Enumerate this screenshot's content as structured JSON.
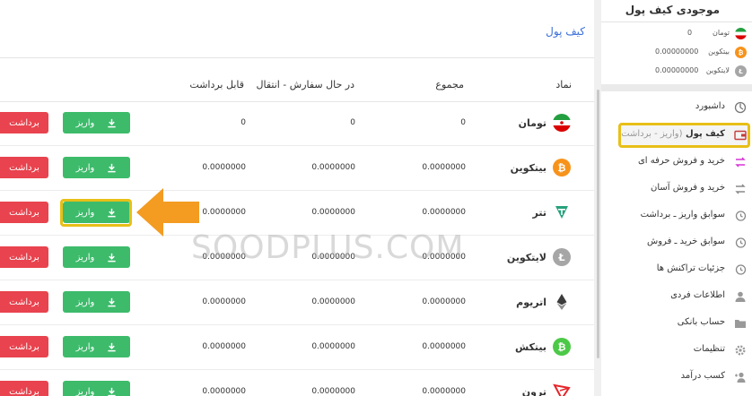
{
  "page_title": "کیف پول",
  "table": {
    "headers": {
      "asset": "نماد",
      "total": "مجموع",
      "in_order": "در حال سفارش - انتقال",
      "withdrawable": "قابل برداشت"
    },
    "deposit_label": "واریز",
    "withdraw_label": "برداشت",
    "rows": [
      {
        "name": "تومان",
        "total": "0",
        "in_order": "0",
        "withdrawable": "0",
        "icon": "iran-flag-icon",
        "color": "#ffffff"
      },
      {
        "name": "بیتکوین",
        "total": "0.0000000",
        "in_order": "0.0000000",
        "withdrawable": "0.0000000",
        "icon": "bitcoin-icon",
        "color": "#f7931a"
      },
      {
        "name": "تتر",
        "total": "0.0000000",
        "in_order": "0.0000000",
        "withdrawable": "0.0000000",
        "icon": "tether-icon",
        "color": "#26a17b"
      },
      {
        "name": "لایتکوین",
        "total": "0.0000000",
        "in_order": "0.0000000",
        "withdrawable": "0.0000000",
        "icon": "litecoin-icon",
        "color": "#a6a6a6"
      },
      {
        "name": "اتریوم",
        "total": "0.0000000",
        "in_order": "0.0000000",
        "withdrawable": "0.0000000",
        "icon": "ethereum-icon",
        "color": "#3c3c3d"
      },
      {
        "name": "بیتکش",
        "total": "0.0000000",
        "in_order": "0.0000000",
        "withdrawable": "0.0000000",
        "icon": "bitcoin-cash-icon",
        "color": "#4cc947"
      },
      {
        "name": "ترون",
        "total": "0.0000000",
        "in_order": "0.0000000",
        "withdrawable": "0.0000000",
        "icon": "tron-icon",
        "color": "#e5262b"
      }
    ]
  },
  "watermark": "SOODPLUS.COM",
  "sidebar": {
    "title": "موجودی کیف پول",
    "balances": [
      {
        "name": "تومان",
        "value": "0"
      },
      {
        "name": "بیتکوین",
        "value": "0.00000000"
      },
      {
        "name": "لایتکوین",
        "value": "0.00000000"
      }
    ],
    "menu": [
      {
        "label": "داشبورد",
        "icon": "dashboard-icon"
      },
      {
        "label": "کیف پول",
        "sub": "(واریز - برداشت)",
        "icon": "wallet-icon",
        "active": true
      },
      {
        "label": "خرید و فروش حرفه ای",
        "icon": "pro-trade-icon"
      },
      {
        "label": "خرید و فروش آسان",
        "icon": "easy-trade-icon"
      },
      {
        "label": "سوابق واریز ـ برداشت",
        "icon": "history-icon"
      },
      {
        "label": "سوابق خرید ـ فروش",
        "icon": "history-icon"
      },
      {
        "label": "جزئیات تراکنش ها",
        "icon": "history-icon"
      },
      {
        "label": "اطلاعات فردی",
        "icon": "user-icon"
      },
      {
        "label": "حساب بانکی",
        "icon": "bank-folder-icon"
      },
      {
        "label": "تنظیمات",
        "icon": "gear-icon"
      },
      {
        "label": "کسب درآمد",
        "icon": "add-user-icon"
      }
    ]
  },
  "colors": {
    "deposit": "#3dbb6b",
    "withdraw": "#e8434e",
    "highlight": "#e8bf17",
    "arrow": "#f39c21",
    "title_link": "#3a6fd8"
  }
}
